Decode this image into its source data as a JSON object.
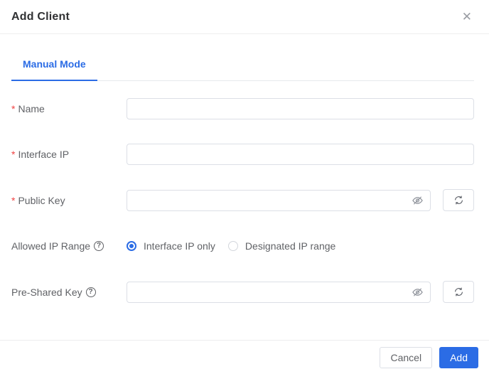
{
  "dialog": {
    "title": "Add Client"
  },
  "icons": {
    "close": "✕",
    "help": "?",
    "eye_hidden": "eye-slash-glyph",
    "refresh": "circular-arrows-glyph"
  },
  "tabs": {
    "active_index": 0,
    "items": [
      {
        "label": "Manual Mode"
      }
    ]
  },
  "form": {
    "required_marker": "*",
    "fields": {
      "name": {
        "label": "Name",
        "required": true,
        "value": "",
        "placeholder": ""
      },
      "interface_ip": {
        "label": "Interface IP",
        "required": true,
        "value": "",
        "placeholder": ""
      },
      "public_key": {
        "label": "Public Key",
        "required": true,
        "value": "",
        "placeholder": "",
        "has_visibility_toggle": true,
        "has_regenerate_button": true
      },
      "allowed_ip_range": {
        "label": "Allowed IP Range",
        "has_help": true,
        "options": [
          {
            "label": "Interface IP only",
            "selected": true
          },
          {
            "label": "Designated IP range",
            "selected": false
          }
        ]
      },
      "pre_shared_key": {
        "label": "Pre-Shared Key",
        "required": false,
        "has_help": true,
        "value": "",
        "placeholder": "",
        "has_visibility_toggle": true,
        "has_regenerate_button": true
      }
    }
  },
  "footer": {
    "cancel_label": "Cancel",
    "add_label": "Add"
  },
  "colors": {
    "accent_blue": "#2b6ce5",
    "required_red": "#f04343",
    "title_text": "#303133",
    "label_text": "#606266",
    "input_border": "#dcdfe6",
    "divider": "#ececee",
    "icon_gray": "#8f939b"
  }
}
